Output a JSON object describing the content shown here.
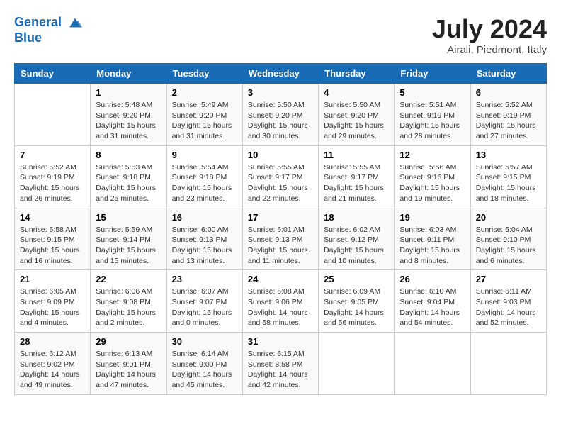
{
  "header": {
    "logo_line1": "General",
    "logo_line2": "Blue",
    "month": "July 2024",
    "location": "Airali, Piedmont, Italy"
  },
  "weekdays": [
    "Sunday",
    "Monday",
    "Tuesday",
    "Wednesday",
    "Thursday",
    "Friday",
    "Saturday"
  ],
  "weeks": [
    [
      {
        "day": "",
        "sunrise": "",
        "sunset": "",
        "daylight": ""
      },
      {
        "day": "1",
        "sunrise": "Sunrise: 5:48 AM",
        "sunset": "Sunset: 9:20 PM",
        "daylight": "Daylight: 15 hours and 31 minutes."
      },
      {
        "day": "2",
        "sunrise": "Sunrise: 5:49 AM",
        "sunset": "Sunset: 9:20 PM",
        "daylight": "Daylight: 15 hours and 31 minutes."
      },
      {
        "day": "3",
        "sunrise": "Sunrise: 5:50 AM",
        "sunset": "Sunset: 9:20 PM",
        "daylight": "Daylight: 15 hours and 30 minutes."
      },
      {
        "day": "4",
        "sunrise": "Sunrise: 5:50 AM",
        "sunset": "Sunset: 9:20 PM",
        "daylight": "Daylight: 15 hours and 29 minutes."
      },
      {
        "day": "5",
        "sunrise": "Sunrise: 5:51 AM",
        "sunset": "Sunset: 9:19 PM",
        "daylight": "Daylight: 15 hours and 28 minutes."
      },
      {
        "day": "6",
        "sunrise": "Sunrise: 5:52 AM",
        "sunset": "Sunset: 9:19 PM",
        "daylight": "Daylight: 15 hours and 27 minutes."
      }
    ],
    [
      {
        "day": "7",
        "sunrise": "Sunrise: 5:52 AM",
        "sunset": "Sunset: 9:19 PM",
        "daylight": "Daylight: 15 hours and 26 minutes."
      },
      {
        "day": "8",
        "sunrise": "Sunrise: 5:53 AM",
        "sunset": "Sunset: 9:18 PM",
        "daylight": "Daylight: 15 hours and 25 minutes."
      },
      {
        "day": "9",
        "sunrise": "Sunrise: 5:54 AM",
        "sunset": "Sunset: 9:18 PM",
        "daylight": "Daylight: 15 hours and 23 minutes."
      },
      {
        "day": "10",
        "sunrise": "Sunrise: 5:55 AM",
        "sunset": "Sunset: 9:17 PM",
        "daylight": "Daylight: 15 hours and 22 minutes."
      },
      {
        "day": "11",
        "sunrise": "Sunrise: 5:55 AM",
        "sunset": "Sunset: 9:17 PM",
        "daylight": "Daylight: 15 hours and 21 minutes."
      },
      {
        "day": "12",
        "sunrise": "Sunrise: 5:56 AM",
        "sunset": "Sunset: 9:16 PM",
        "daylight": "Daylight: 15 hours and 19 minutes."
      },
      {
        "day": "13",
        "sunrise": "Sunrise: 5:57 AM",
        "sunset": "Sunset: 9:15 PM",
        "daylight": "Daylight: 15 hours and 18 minutes."
      }
    ],
    [
      {
        "day": "14",
        "sunrise": "Sunrise: 5:58 AM",
        "sunset": "Sunset: 9:15 PM",
        "daylight": "Daylight: 15 hours and 16 minutes."
      },
      {
        "day": "15",
        "sunrise": "Sunrise: 5:59 AM",
        "sunset": "Sunset: 9:14 PM",
        "daylight": "Daylight: 15 hours and 15 minutes."
      },
      {
        "day": "16",
        "sunrise": "Sunrise: 6:00 AM",
        "sunset": "Sunset: 9:13 PM",
        "daylight": "Daylight: 15 hours and 13 minutes."
      },
      {
        "day": "17",
        "sunrise": "Sunrise: 6:01 AM",
        "sunset": "Sunset: 9:13 PM",
        "daylight": "Daylight: 15 hours and 11 minutes."
      },
      {
        "day": "18",
        "sunrise": "Sunrise: 6:02 AM",
        "sunset": "Sunset: 9:12 PM",
        "daylight": "Daylight: 15 hours and 10 minutes."
      },
      {
        "day": "19",
        "sunrise": "Sunrise: 6:03 AM",
        "sunset": "Sunset: 9:11 PM",
        "daylight": "Daylight: 15 hours and 8 minutes."
      },
      {
        "day": "20",
        "sunrise": "Sunrise: 6:04 AM",
        "sunset": "Sunset: 9:10 PM",
        "daylight": "Daylight: 15 hours and 6 minutes."
      }
    ],
    [
      {
        "day": "21",
        "sunrise": "Sunrise: 6:05 AM",
        "sunset": "Sunset: 9:09 PM",
        "daylight": "Daylight: 15 hours and 4 minutes."
      },
      {
        "day": "22",
        "sunrise": "Sunrise: 6:06 AM",
        "sunset": "Sunset: 9:08 PM",
        "daylight": "Daylight: 15 hours and 2 minutes."
      },
      {
        "day": "23",
        "sunrise": "Sunrise: 6:07 AM",
        "sunset": "Sunset: 9:07 PM",
        "daylight": "Daylight: 15 hours and 0 minutes."
      },
      {
        "day": "24",
        "sunrise": "Sunrise: 6:08 AM",
        "sunset": "Sunset: 9:06 PM",
        "daylight": "Daylight: 14 hours and 58 minutes."
      },
      {
        "day": "25",
        "sunrise": "Sunrise: 6:09 AM",
        "sunset": "Sunset: 9:05 PM",
        "daylight": "Daylight: 14 hours and 56 minutes."
      },
      {
        "day": "26",
        "sunrise": "Sunrise: 6:10 AM",
        "sunset": "Sunset: 9:04 PM",
        "daylight": "Daylight: 14 hours and 54 minutes."
      },
      {
        "day": "27",
        "sunrise": "Sunrise: 6:11 AM",
        "sunset": "Sunset: 9:03 PM",
        "daylight": "Daylight: 14 hours and 52 minutes."
      }
    ],
    [
      {
        "day": "28",
        "sunrise": "Sunrise: 6:12 AM",
        "sunset": "Sunset: 9:02 PM",
        "daylight": "Daylight: 14 hours and 49 minutes."
      },
      {
        "day": "29",
        "sunrise": "Sunrise: 6:13 AM",
        "sunset": "Sunset: 9:01 PM",
        "daylight": "Daylight: 14 hours and 47 minutes."
      },
      {
        "day": "30",
        "sunrise": "Sunrise: 6:14 AM",
        "sunset": "Sunset: 9:00 PM",
        "daylight": "Daylight: 14 hours and 45 minutes."
      },
      {
        "day": "31",
        "sunrise": "Sunrise: 6:15 AM",
        "sunset": "Sunset: 8:58 PM",
        "daylight": "Daylight: 14 hours and 42 minutes."
      },
      {
        "day": "",
        "sunrise": "",
        "sunset": "",
        "daylight": ""
      },
      {
        "day": "",
        "sunrise": "",
        "sunset": "",
        "daylight": ""
      },
      {
        "day": "",
        "sunrise": "",
        "sunset": "",
        "daylight": ""
      }
    ]
  ]
}
